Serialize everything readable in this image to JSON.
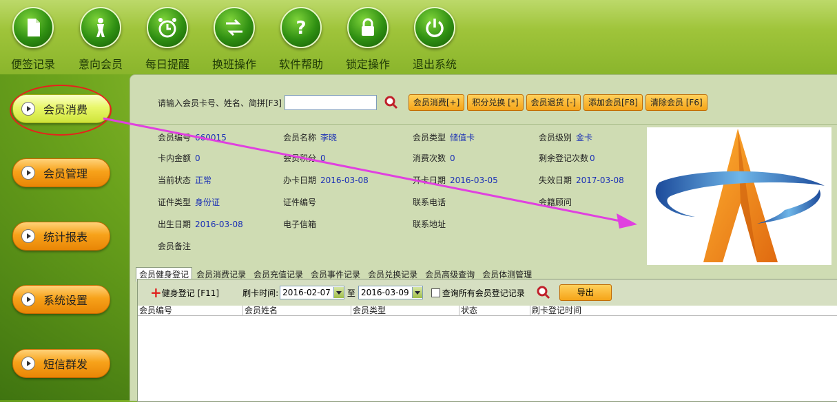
{
  "toolbar": {
    "items": [
      {
        "label": "便签记录",
        "icon": "note-icon"
      },
      {
        "label": "意向会员",
        "icon": "person-icon"
      },
      {
        "label": "每日提醒",
        "icon": "alarm-clock-icon"
      },
      {
        "label": "换班操作",
        "icon": "swap-arrows-icon"
      },
      {
        "label": "软件帮助",
        "icon": "help-icon"
      },
      {
        "label": "锁定操作",
        "icon": "lock-icon"
      },
      {
        "label": "退出系统",
        "icon": "power-icon"
      }
    ]
  },
  "nav": {
    "items": [
      {
        "label": "会员消费"
      },
      {
        "label": "会员管理"
      },
      {
        "label": "统计报表"
      },
      {
        "label": "系统设置"
      },
      {
        "label": "短信群发"
      }
    ],
    "active_index": 0
  },
  "search": {
    "label": "请输入会员卡号、姓名、简拼[F3]",
    "value": "",
    "buttons": [
      "会员消费[+]",
      "积分兑换 [*]",
      "会员退货 [-]",
      "添加会员[F8]",
      "清除会员 [F6]"
    ]
  },
  "member": {
    "number_label": "会员编号",
    "number": "660015",
    "name_label": "会员名称",
    "name": "李晓",
    "type_label": "会员类型",
    "type": "储值卡",
    "level_label": "会员级别",
    "level": "金卡",
    "balance_label": "卡内金额",
    "balance": "0",
    "points_label": "会员积分",
    "points": "0",
    "consume_label": "消费次数",
    "consume": "0",
    "remain_label": "剩余登记次数",
    "remain": "0",
    "status_label": "当前状态",
    "status": "正常",
    "issue_label": "办卡日期",
    "issue": "2016-03-08",
    "open_label": "开卡日期",
    "open": "2016-03-05",
    "expire_label": "失效日期",
    "expire": "2017-03-08",
    "idtype_label": "证件类型",
    "idtype": "身份证",
    "idno_label": "证件编号",
    "idno": "",
    "phone_label": "联系电话",
    "phone": "",
    "advisor_label": "会籍顾问",
    "advisor": "",
    "birth_label": "出生日期",
    "birth": "2016-03-08",
    "email_label": "电子信箱",
    "email": "",
    "address_label": "联系地址",
    "address": "",
    "remark_label": "会员备注",
    "remark": ""
  },
  "tabs": [
    "会员健身登记",
    "会员消费记录",
    "会员充值记录",
    "会员事件记录",
    "会员兑换记录",
    "会员高级查询",
    "会员体测管理"
  ],
  "active_tab": 0,
  "subbar": {
    "register": "健身登记 [F11]",
    "time_label": "刷卡时间:",
    "date_from": "2016-02-07",
    "to_label": "至",
    "date_to": "2016-03-09",
    "query_all": "查询所有会员登记记录",
    "export": "导出"
  },
  "grid": {
    "columns": [
      "会员编号",
      "会员姓名",
      "会员类型",
      "状态",
      "刷卡登记时间"
    ],
    "rows": []
  },
  "colors": {
    "accent": "#f5a418",
    "annotation_ring": "#e8201c",
    "annotation_arrow": "#e040e0"
  }
}
